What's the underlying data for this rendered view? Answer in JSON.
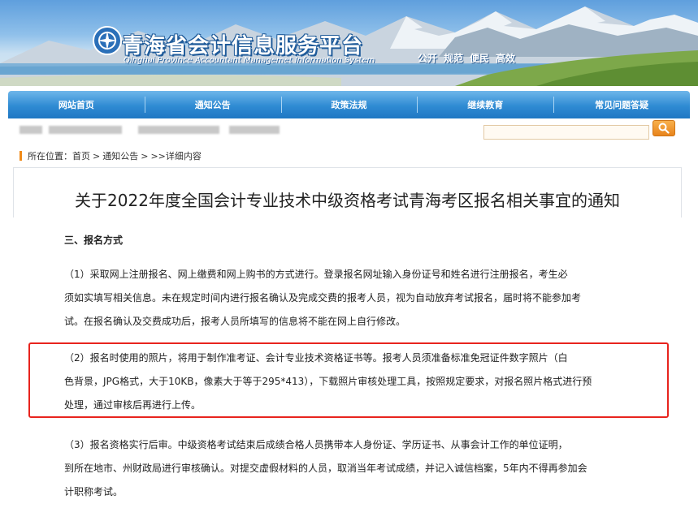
{
  "header": {
    "title": "青海省会计信息服务平台",
    "subtitle": "Qinghai Province Accountant Managemet Information System",
    "slogans": [
      "公开",
      "规范",
      "便民",
      "高效"
    ]
  },
  "nav": {
    "items": [
      {
        "label": "网站首页"
      },
      {
        "label": "通知公告"
      },
      {
        "label": "政策法规"
      },
      {
        "label": "继续教育"
      },
      {
        "label": "常见问题答疑"
      }
    ]
  },
  "search": {
    "value": "",
    "placeholder": ""
  },
  "breadcrumb": {
    "prefix": "所在位置：",
    "items": [
      "首页",
      "通知公告",
      ">>详细内容"
    ],
    "separator": ">"
  },
  "article": {
    "title": "关于2022年度全国会计专业技术中级资格考试青海考区报名相关事宜的通知",
    "section_heading": "三、报名方式",
    "paragraphs": [
      {
        "lines": [
          "（1）采取网上注册报名、网上缴费和网上购书的方式进行。登录报名网址输入身份证号和姓名进行注册报名，考生必",
          "须如实填写相关信息。未在规定时间内进行报名确认及完成交费的报考人员，视为自动放弃考试报名，届时将不能参加考",
          "试。在报名确认及交费成功后，报考人员所填写的信息将不能在网上自行修改。"
        ]
      },
      {
        "lines": [
          "（2）报名时使用的照片，将用于制作准考证、会计专业技术资格证书等。报考人员须准备标准免冠证件数字照片（白",
          "色背景，JPG格式，大于10KB，像素大于等于295*413），下载照片审核处理工具，按照规定要求，对报名照片格式进行预",
          "处理，通过审核后再进行上传。"
        ]
      },
      {
        "lines": [
          "（3）报名资格实行后审。中级资格考试结束后成绩合格人员携带本人身份证、学历证书、从事会计工作的单位证明，",
          "到所在地市、州财政局进行审核确认。对提交虚假材料的人员，取消当年考试成绩，并记入诚信档案，5年内不得再参加会",
          "计职称考试。"
        ]
      }
    ]
  },
  "colors": {
    "nav_bg": "#2f8bd3",
    "highlight_border": "#e8241e",
    "breadcrumb_marker": "#f08a17",
    "search_button": "#e8841d"
  },
  "icons": {
    "search": "magnifier-icon",
    "logo": "site-logo-emblem"
  }
}
